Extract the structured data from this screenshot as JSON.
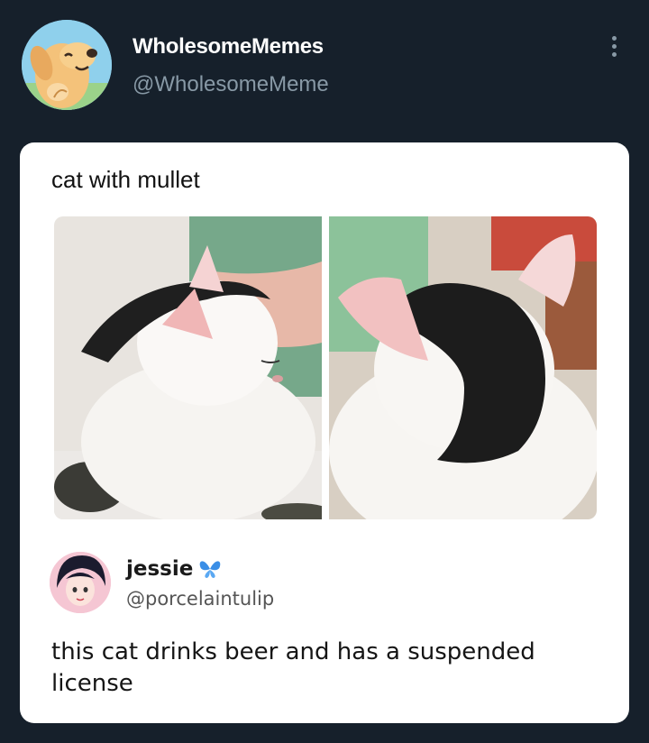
{
  "post": {
    "author": {
      "display_name": "WholesomeMemes",
      "handle": "@WholesomeMeme",
      "avatar_icon": "dog-avatar"
    },
    "menu_icon": "more-vertical-icon",
    "card": {
      "caption": "cat with mullet",
      "images": [
        {
          "name": "cat-side-photo",
          "alt_icon": "cat-photo"
        },
        {
          "name": "cat-back-photo",
          "alt_icon": "cat-photo"
        }
      ],
      "quote": {
        "display_name": "jessie",
        "badge_icon": "butterfly-icon",
        "handle": "@porcelaintulip",
        "text": "this cat drinks beer and has a suspended license"
      }
    }
  },
  "colors": {
    "background": "#16202b",
    "card": "#ffffff",
    "name": "#ffffff",
    "handle": "#8899a6",
    "butterfly": "#3a8ee6"
  }
}
